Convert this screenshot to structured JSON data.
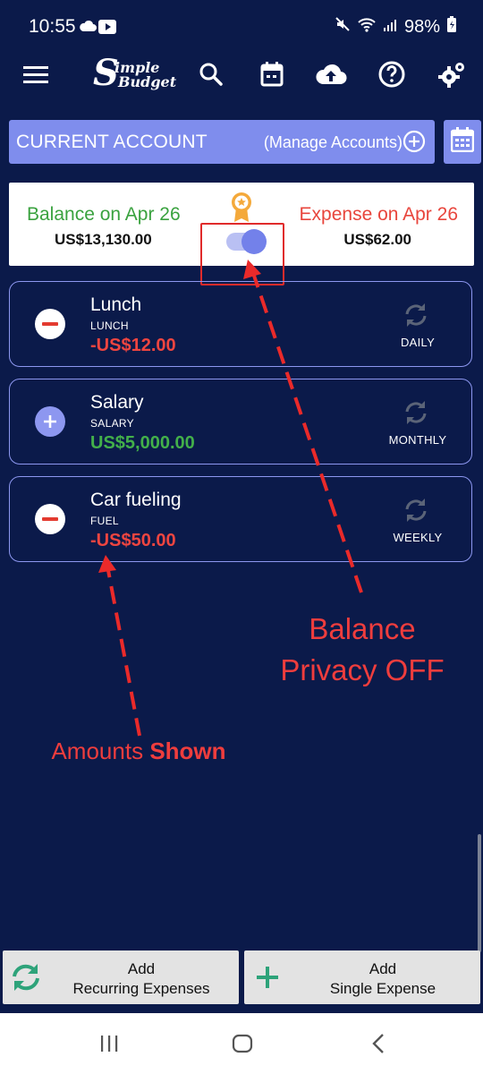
{
  "status_bar": {
    "time": "10:55",
    "battery": "98%"
  },
  "toolbar": {
    "logo_letter": "S",
    "logo_line1": "imple",
    "logo_line2": "Budget"
  },
  "account": {
    "name": "CURRENT ACCOUNT",
    "manage_label": "(Manage Accounts)"
  },
  "summary": {
    "balance_label": "Balance on Apr 26",
    "balance_value": "US$13,130.00",
    "expense_label": "Expense on Apr 26",
    "expense_value": "US$62.00",
    "privacy_toggle_on": true
  },
  "transactions": [
    {
      "name": "Lunch",
      "category": "LUNCH",
      "amount": "-US$12.00",
      "type": "expense",
      "frequency": "DAILY"
    },
    {
      "name": "Salary",
      "category": "SALARY",
      "amount": "US$5,000.00",
      "type": "income",
      "frequency": "MONTHLY"
    },
    {
      "name": "Car fueling",
      "category": "FUEL",
      "amount": "-US$50.00",
      "type": "expense",
      "frequency": "WEEKLY"
    }
  ],
  "annotations": {
    "privacy_line1": "Balance",
    "privacy_line2": "Privacy OFF",
    "amounts_prefix": "Amounts",
    "amounts_bold": "Shown"
  },
  "buttons": {
    "recurring_line1": "Add",
    "recurring_line2": "Recurring Expenses",
    "single_line1": "Add",
    "single_line2": "Single Expense"
  },
  "colors": {
    "background": "#0b1a4a",
    "accent": "#7f8ded",
    "income": "#43b04a",
    "expense": "#ef4540",
    "annotation": "#ef3d3d"
  }
}
